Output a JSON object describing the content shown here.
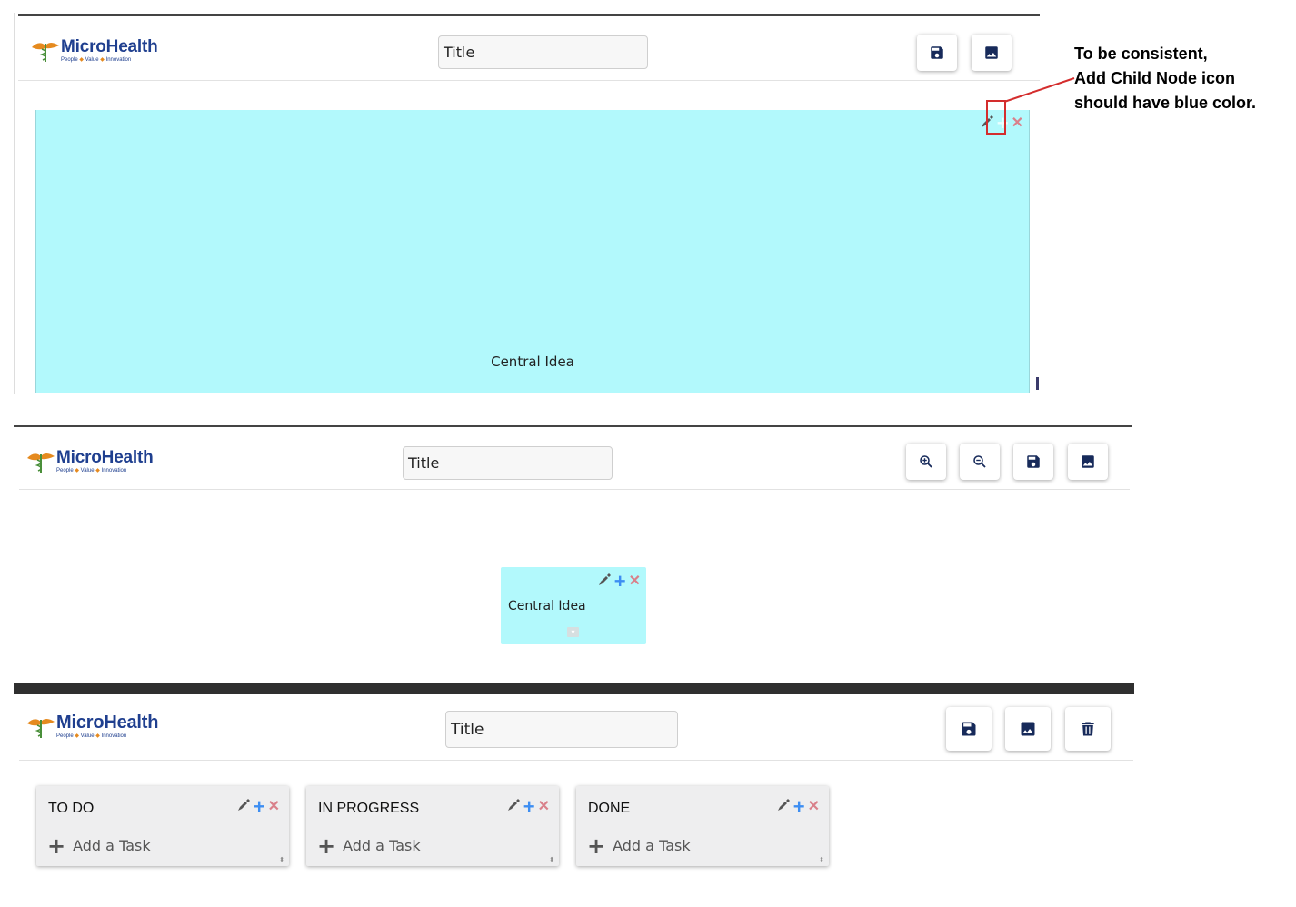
{
  "app": {
    "logo_name": "MicroHealth",
    "logo_tagline": [
      "People",
      "Value",
      "Innovation"
    ]
  },
  "annotation": {
    "lines": [
      "To be consistent,",
      "Add Child Node icon",
      "should have blue color."
    ],
    "highlight_color": "#d42d2d"
  },
  "panel1": {
    "title_value": "Title",
    "buttons": [
      "save-icon",
      "image-icon"
    ],
    "node": {
      "label": "Central Idea",
      "bg": "#b2f9fc",
      "add_icon_color": "#e8ffff"
    }
  },
  "panel2": {
    "title_value": "Title",
    "buttons": [
      "zoom-in-icon",
      "zoom-out-icon",
      "save-icon",
      "image-icon"
    ],
    "node": {
      "label": "Central Idea",
      "bg": "#b2f9fc",
      "add_icon_color": "#3d8ef2"
    }
  },
  "panel3": {
    "title_value": "Title",
    "buttons": [
      "save-icon",
      "image-icon",
      "trash-icon"
    ],
    "columns": [
      {
        "title": "TO DO",
        "add_label": "Add a Task"
      },
      {
        "title": "IN PROGRESS",
        "add_label": "Add a Task"
      },
      {
        "title": "DONE",
        "add_label": "Add a Task"
      }
    ]
  },
  "colors": {
    "brand_navy": "#172a5a",
    "accent_blue": "#3d8ef2",
    "delete_red": "#d9808a",
    "kanban_bg": "#eeeeef"
  }
}
